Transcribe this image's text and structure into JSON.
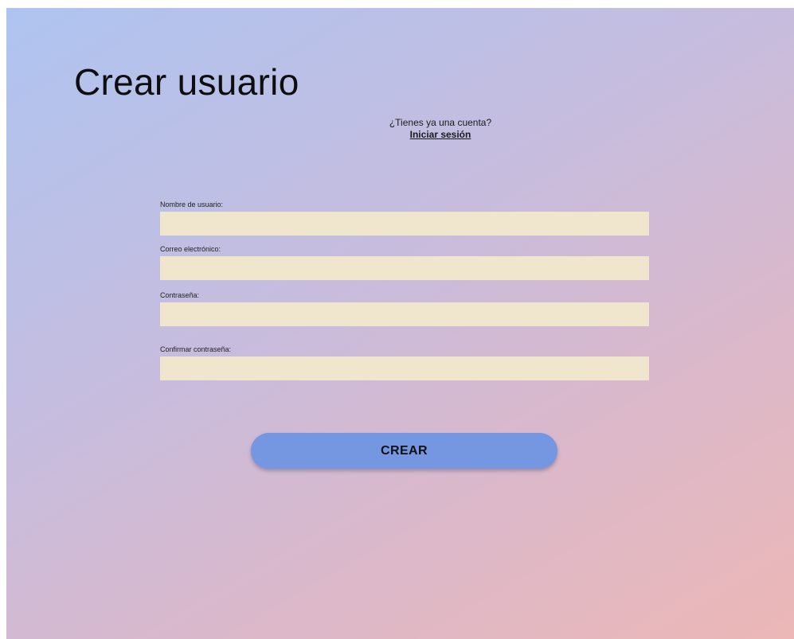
{
  "header": {
    "title": "Crear usuario"
  },
  "login": {
    "prompt": "¿Tienes ya una cuenta?",
    "link_label": "Iniciar sesión"
  },
  "form": {
    "username_label": "Nombre de usuario:",
    "username_value": "",
    "email_label": "Correo electrónico:",
    "email_value": "",
    "password_label": "Contraseña:",
    "password_value": "",
    "confirm_label": "Confirmar contraseña:",
    "confirm_value": "",
    "submit_label": "CREAR"
  },
  "colors": {
    "gradient_start": "#aec4f0",
    "gradient_end": "#ecb7b6",
    "input_background": "#f0e6cd",
    "button_background": "#7596e1"
  }
}
